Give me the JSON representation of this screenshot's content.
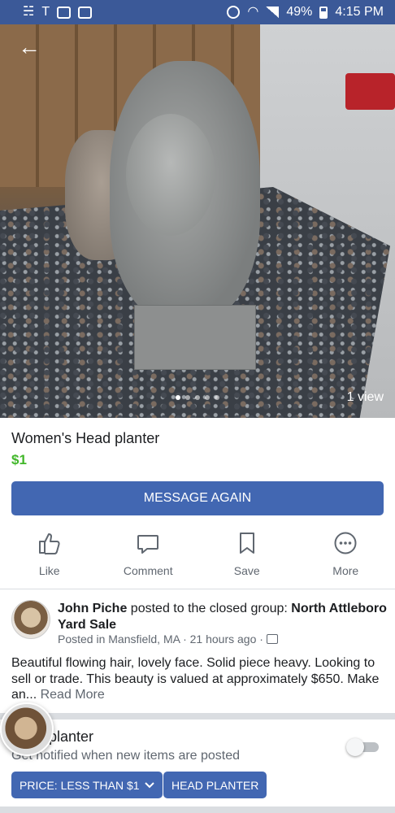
{
  "status_bar": {
    "battery": "49%",
    "time": "4:15 PM"
  },
  "photo": {
    "views": "1 view",
    "dot_count": 5,
    "active_dot": 0
  },
  "listing": {
    "title": "Women's Head planter",
    "price": "$1",
    "price_color": "#42b72a",
    "message_button": "MESSAGE AGAIN",
    "accent_color": "#4267b2"
  },
  "actions": [
    {
      "label": "Like",
      "icon": "thumbs-up-icon"
    },
    {
      "label": "Comment",
      "icon": "comment-icon"
    },
    {
      "label": "Save",
      "icon": "bookmark-icon"
    },
    {
      "label": "More",
      "icon": "more-icon"
    }
  ],
  "post": {
    "author": "John Piche",
    "action_text": " posted to the closed group: ",
    "group": "North Attleboro Yard Sale",
    "meta": "Posted in Mansfield, MA · 21 hours ago ·",
    "description": "Beautiful flowing hair, lovely face. Solid piece heavy. Looking to sell or trade. This beauty is valued at approximately $650. Make an...",
    "read_more": "Read More"
  },
  "alert": {
    "title": "planter",
    "subtitle": "Get notified when new items are posted",
    "toggle_on": false,
    "chips": [
      {
        "label": "PRICE: LESS THAN $1",
        "has_dropdown": true
      },
      {
        "label": "HEAD PLANTER",
        "has_dropdown": false
      }
    ]
  }
}
